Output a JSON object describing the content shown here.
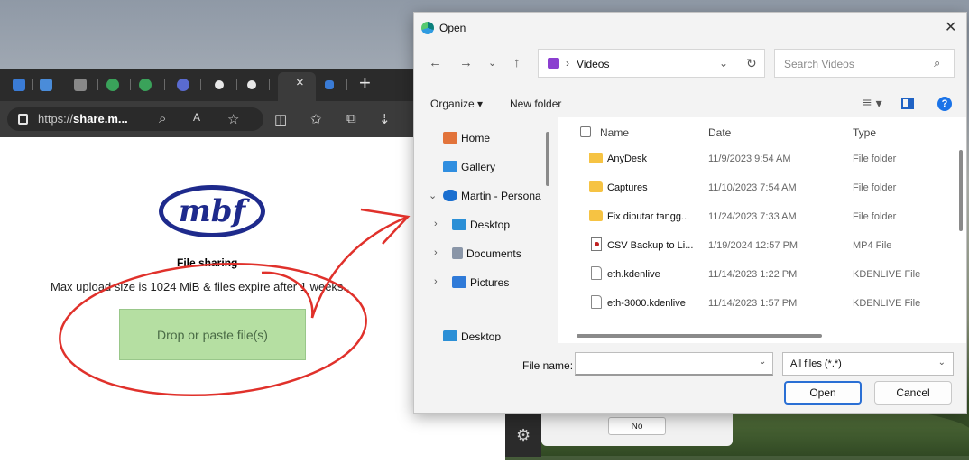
{
  "browser": {
    "url_prefix": "https://",
    "url_domain": "share.m...",
    "tab_close": "×",
    "tab_new": "+"
  },
  "page": {
    "logo_text": "mbf",
    "title": "File sharing",
    "description": "Max upload size is 1024 MiB & files expire after 1 weeks..",
    "drop_button": "Drop or paste file(s)"
  },
  "background_dialog": {
    "no_button": "No"
  },
  "dialog": {
    "title": "Open",
    "close_glyph": "✕",
    "path": {
      "separator": "›",
      "folder": "Videos"
    },
    "search": {
      "placeholder": "Search Videos"
    },
    "commands": {
      "organize": "Organize ▾",
      "new_folder": "New folder"
    },
    "nav": {
      "home": "Home",
      "gallery": "Gallery",
      "onedrive": "Martin - Persona",
      "desktop": "Desktop",
      "documents": "Documents",
      "pictures": "Pictures",
      "desktop2": "Desktop"
    },
    "columns": {
      "name": "Name",
      "date": "Date",
      "type": "Type"
    },
    "files": [
      {
        "name": "AnyDesk",
        "date": "11/9/2023 9:54 AM",
        "type": "File folder",
        "icon": "folder-icon"
      },
      {
        "name": "Captures",
        "date": "11/10/2023 7:54 AM",
        "type": "File folder",
        "icon": "folder-icon"
      },
      {
        "name": "Fix diputar tangg...",
        "date": "11/24/2023 7:33 AM",
        "type": "File folder",
        "icon": "folder-icon"
      },
      {
        "name": "CSV Backup to Li...",
        "date": "1/19/2024 12:57 PM",
        "type": "MP4 File",
        "icon": "video-file-icon"
      },
      {
        "name": "eth.kdenlive",
        "date": "11/14/2023 1:22 PM",
        "type": "KDENLIVE File",
        "icon": "document-icon"
      },
      {
        "name": "eth-3000.kdenlive",
        "date": "11/14/2023 1:57 PM",
        "type": "KDENLIVE File",
        "icon": "document-icon"
      }
    ],
    "file_name_label": "File name:",
    "file_name_value": "",
    "filter_value": "All files (*.*)",
    "open_button": "Open",
    "cancel_button": "Cancel"
  },
  "colors": {
    "drop_button_bg": "#b5dfa2",
    "logo_blue": "#1e2a8c",
    "annotation_red": "#e0312b",
    "primary_button_border": "#2a6fd4"
  }
}
